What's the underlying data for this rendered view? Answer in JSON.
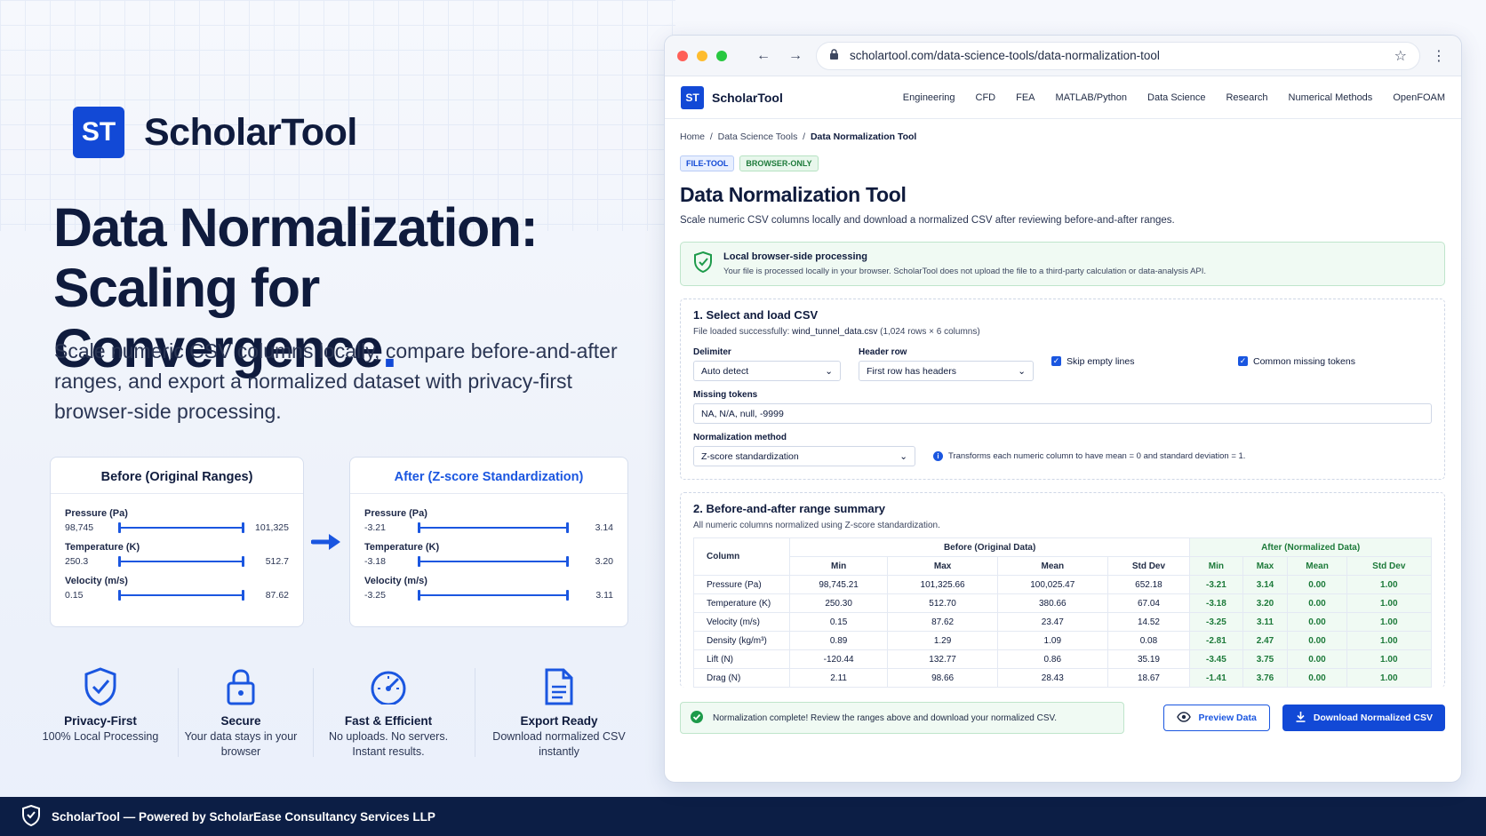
{
  "left": {
    "brand": {
      "logo": "ST",
      "name": "ScholarTool"
    },
    "headline_line1": "Data Normalization:",
    "headline_line2": "Scaling for Convergence",
    "headline_dot": ".",
    "subtitle": "Scale numeric CSV columns locally, compare before-and-after ranges, and export a normalized dataset with privacy-first browser-side processing.",
    "before_card": {
      "title": "Before (Original Ranges)",
      "rows": [
        {
          "label": "Pressure (Pa)",
          "min": "98,745",
          "max": "101,325"
        },
        {
          "label": "Temperature (K)",
          "min": "250.3",
          "max": "512.7"
        },
        {
          "label": "Velocity (m/s)",
          "min": "0.15",
          "max": "87.62"
        }
      ]
    },
    "after_card": {
      "title": "After (Z-score Standardization)",
      "rows": [
        {
          "label": "Pressure (Pa)",
          "min": "-3.21",
          "max": "3.14"
        },
        {
          "label": "Temperature (K)",
          "min": "-3.18",
          "max": "3.20"
        },
        {
          "label": "Velocity (m/s)",
          "min": "-3.25",
          "max": "3.11"
        }
      ]
    },
    "features": [
      {
        "icon": "shield-check-icon",
        "title": "Privacy-First",
        "desc": "100% Local Processing"
      },
      {
        "icon": "lock-icon",
        "title": "Secure",
        "desc": "Your data stays in your browser"
      },
      {
        "icon": "speedometer-icon",
        "title": "Fast & Efficient",
        "desc": "No uploads. No servers. Instant results."
      },
      {
        "icon": "document-icon",
        "title": "Export Ready",
        "desc": "Download normalized CSV instantly"
      }
    ]
  },
  "footer": {
    "text": "ScholarTool — Powered by ScholarEase Consultancy Services LLP"
  },
  "browser": {
    "url": "scholartool.com/data-science-tools/data-normalization-tool",
    "site": {
      "logo": "ST",
      "name": "ScholarTool"
    },
    "nav": [
      "Engineering",
      "CFD",
      "FEA",
      "MATLAB/Python",
      "Data Science",
      "Research",
      "Numerical Methods",
      "OpenFOAM"
    ],
    "breadcrumb": {
      "home": "Home",
      "sep": "/",
      "parent": "Data Science Tools",
      "current": "Data Normalization Tool"
    },
    "badges": [
      "FILE-TOOL",
      "BROWSER-ONLY"
    ],
    "title": "Data Normalization Tool",
    "description": "Scale numeric CSV columns locally and download a normalized CSV after reviewing before-and-after ranges.",
    "notice": {
      "title": "Local browser-side processing",
      "text": "Your file is processed locally in your browser. ScholarTool does not upload the file to a third-party calculation or data-analysis API."
    },
    "section1": {
      "title": "1.  Select and load CSV",
      "status_prefix": "File loaded successfully: ",
      "filename": "wind_tunnel_data.csv",
      "status_suffix": " (1,024 rows × 6 columns)",
      "delimiter_label": "Delimiter",
      "delimiter_value": "Auto detect",
      "header_label": "Header row",
      "header_value": "First row has headers",
      "skip_empty": "Skip empty lines",
      "missing_common": "Common missing tokens",
      "missing_label": "Missing tokens",
      "missing_value": "NA, N/A, null, -9999",
      "method_label": "Normalization method",
      "method_value": "Z-score standardization",
      "method_info": "Transforms each numeric column to have mean = 0 and standard deviation = 1."
    },
    "section2": {
      "title": "2.  Before-and-after range summary",
      "subtitle": "All numeric columns normalized using Z-score standardization.",
      "col_header": "Column",
      "before_header": "Before (Original Data)",
      "after_header": "After (Normalized Data)",
      "stat_headers": [
        "Min",
        "Max",
        "Mean",
        "Std Dev"
      ],
      "rows": [
        {
          "name": "Pressure (Pa)",
          "before": [
            "98,745.21",
            "101,325.66",
            "100,025.47",
            "652.18"
          ],
          "after": [
            "-3.21",
            "3.14",
            "0.00",
            "1.00"
          ]
        },
        {
          "name": "Temperature (K)",
          "before": [
            "250.30",
            "512.70",
            "380.66",
            "67.04"
          ],
          "after": [
            "-3.18",
            "3.20",
            "0.00",
            "1.00"
          ]
        },
        {
          "name": "Velocity (m/s)",
          "before": [
            "0.15",
            "87.62",
            "23.47",
            "14.52"
          ],
          "after": [
            "-3.25",
            "3.11",
            "0.00",
            "1.00"
          ]
        },
        {
          "name": "Density (kg/m³)",
          "before": [
            "0.89",
            "1.29",
            "1.09",
            "0.08"
          ],
          "after": [
            "-2.81",
            "2.47",
            "0.00",
            "1.00"
          ]
        },
        {
          "name": "Lift (N)",
          "before": [
            "-120.44",
            "132.77",
            "0.86",
            "35.19"
          ],
          "after": [
            "-3.45",
            "3.75",
            "0.00",
            "1.00"
          ]
        },
        {
          "name": "Drag (N)",
          "before": [
            "2.11",
            "98.66",
            "28.43",
            "18.67"
          ],
          "after": [
            "-1.41",
            "3.76",
            "0.00",
            "1.00"
          ]
        }
      ]
    },
    "complete_msg": "Normalization complete! Review the ranges above and download your normalized CSV.",
    "preview_btn": "Preview Data",
    "download_btn": "Download Normalized CSV"
  }
}
